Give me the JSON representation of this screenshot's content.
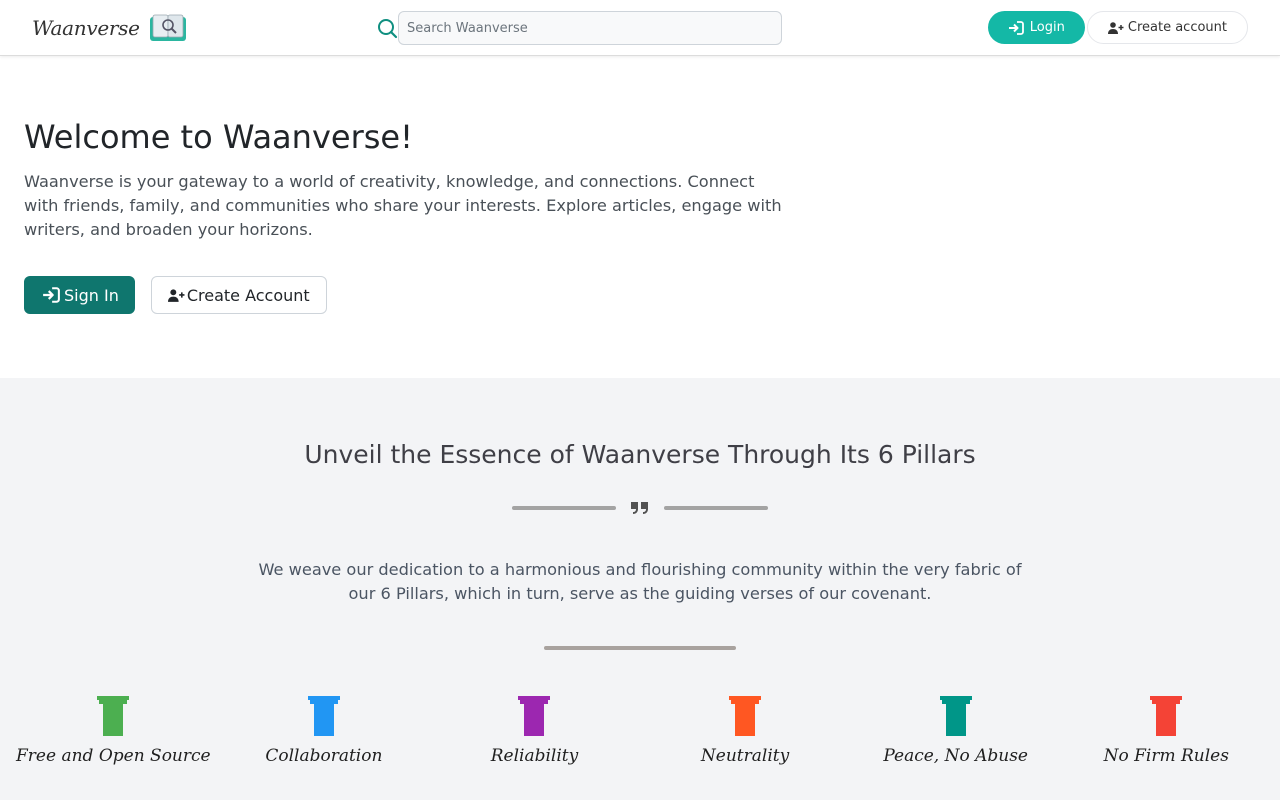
{
  "header": {
    "logo_text": "Waanverse",
    "search_placeholder": "Search Waanverse",
    "login_label": "Login",
    "create_account_label": "Create account"
  },
  "hero": {
    "title": "Welcome to Waanverse!",
    "description": "Waanverse is your gateway to a world of creativity, knowledge, and connections. Connect with friends, family, and communities who share your interests. Explore articles, engage with writers, and broaden your horizons.",
    "signin_label": "Sign In",
    "create_account_label": "Create Account"
  },
  "pillars": {
    "title": "Unveil the Essence of Waanverse Through Its 6 Pillars",
    "description": "We weave our dedication to a harmonious and flourishing community within the very fabric of our 6 Pillars, which in turn, serve as the guiding verses of our covenant.",
    "items": [
      {
        "label": "Free and Open Source",
        "color": "#4caf50"
      },
      {
        "label": "Collaboration",
        "color": "#2196f3"
      },
      {
        "label": "Reliability",
        "color": "#9c27b0"
      },
      {
        "label": "Neutrality",
        "color": "#ff5722"
      },
      {
        "label": "Peace, No Abuse",
        "color": "#009688"
      },
      {
        "label": "No Firm Rules",
        "color": "#f44336"
      }
    ]
  },
  "colors": {
    "brand_teal": "#14b8a6",
    "brand_dark_teal": "#0f766e",
    "section_bg": "#f3f4f6"
  }
}
